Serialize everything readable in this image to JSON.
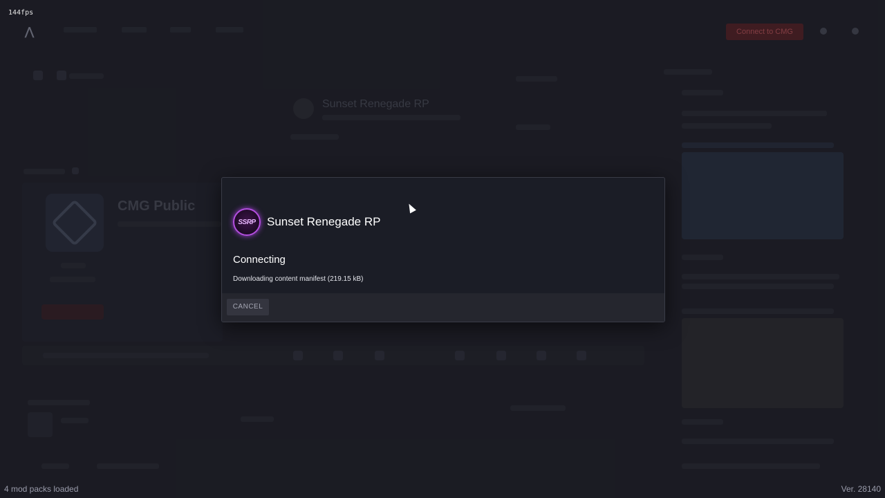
{
  "overlay_fps": "144fps",
  "modal": {
    "server_logo_text": "SSRP",
    "server_name": "Sunset Renegade RP",
    "status_title": "Connecting",
    "status_detail": "Downloading content manifest (219.15 kB)",
    "cancel_label": "CANCEL"
  },
  "footer": {
    "mod_packs": "4 mod packs loaded",
    "version": "Ver. 28140"
  },
  "background": {
    "featured_title": "CMG Public",
    "selected_title": "Sunset Renegade RP",
    "connect_label": "Connect to CMG",
    "colors": {
      "accent": "#b44fe0",
      "modal_bg": "#1b1d26",
      "app_bg": "#22232b"
    }
  }
}
